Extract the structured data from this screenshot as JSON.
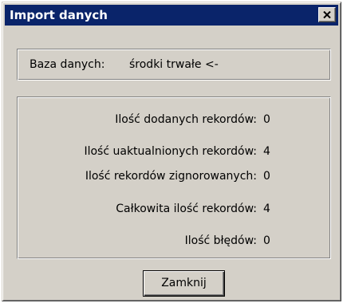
{
  "window": {
    "title": "Import danych",
    "close_glyph": "close-icon"
  },
  "database": {
    "label": "Baza danych:",
    "value": "środki trwałe <-"
  },
  "stats": {
    "added_label": "Ilość dodanych rekordów:",
    "added_value": "0",
    "updated_label": "Ilość uaktualnionych rekordów:",
    "updated_value": "4",
    "ignored_label": "Ilość rekordów zignorowanych:",
    "ignored_value": "0",
    "total_label": "Całkowita ilość rekordów:",
    "total_value": "4",
    "errors_label": "Ilość błędów:",
    "errors_value": "0"
  },
  "buttons": {
    "close_label": "Zamknij"
  },
  "colors": {
    "titlebar": "#0a246a",
    "dialog_face": "#d4d0c8",
    "title_text": "#ffffff"
  }
}
